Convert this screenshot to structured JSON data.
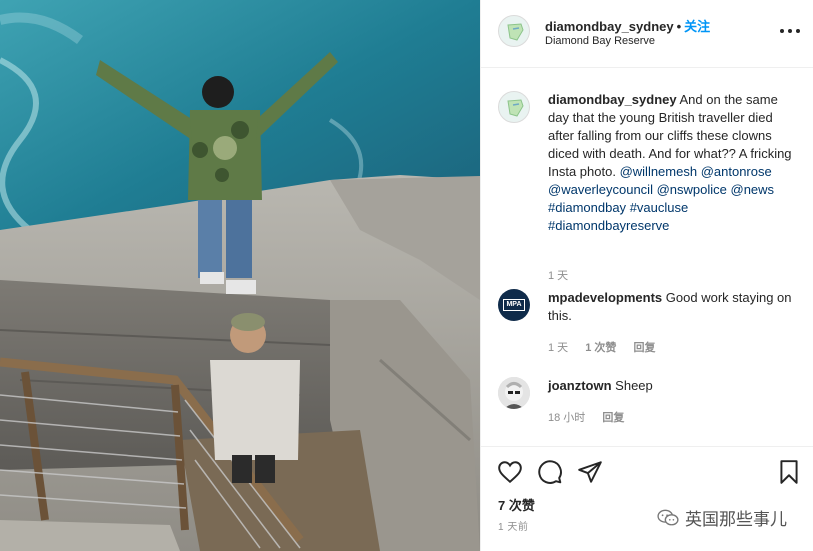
{
  "post": {
    "username": "diamondbay_sydney",
    "separator": "•",
    "follow_label": "关注",
    "location": "Diamond Bay Reserve"
  },
  "caption": {
    "username": "diamondbay_sydney",
    "text": "And on the same day that the young British traveller died after falling from our cliffs these clowns diced with death. And for what?? A fricking Insta photo.",
    "tags": [
      "@willnemesh",
      "@antonrose",
      "@waverleycouncil",
      "@nswpolice",
      "@news",
      "#diamondbay",
      "#vaucluse",
      "#diamondbayreserve"
    ],
    "time": "1 天"
  },
  "comments": [
    {
      "username": "mpadevelopments",
      "avatar_text": "MPA",
      "text": "Good work staying on this.",
      "time": "1 天",
      "likes": "1 次赞",
      "reply": "回复"
    },
    {
      "username": "joanztown",
      "text": "Sheep",
      "time": "18 小时",
      "reply": "回复"
    }
  ],
  "footer": {
    "likes": "7 次赞",
    "time_ago": "1 天前"
  },
  "watermark": "英国那些事儿",
  "icons": {
    "like": "heart-icon",
    "comment": "comment-icon",
    "share": "paper-plane-icon",
    "save": "bookmark-icon",
    "more": "more-dots-icon"
  },
  "colors": {
    "follow": "#0095f6",
    "text": "#262626",
    "muted": "#8e8e8e",
    "mention": "#00376b"
  }
}
